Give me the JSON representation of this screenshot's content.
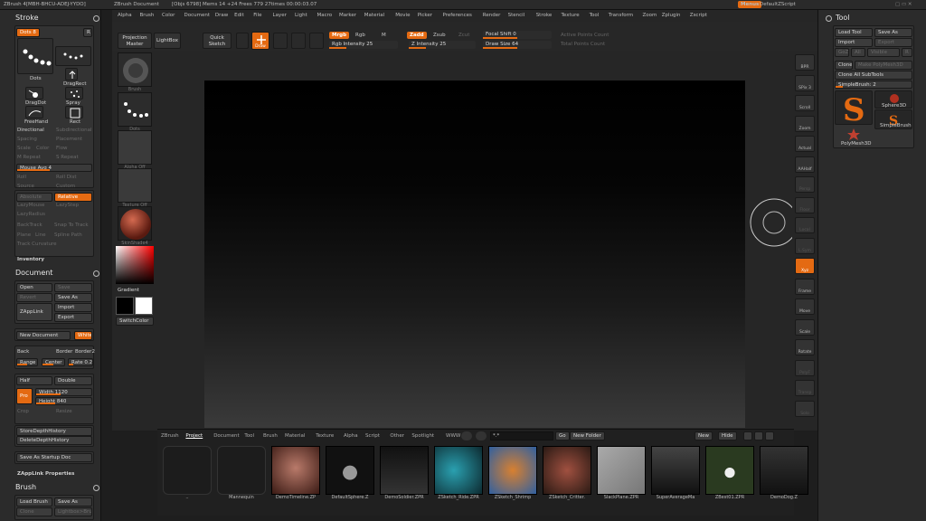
{
  "titlebar": {
    "app": "ZBrush 4[MBH-BHCU-ADEJ-YYDO]",
    "doc": "ZBrush Document",
    "stats": "[Objs 6798] Mems 14 +24 Frees 779 27times 00:00:03.07",
    "menus_btn": "Menus",
    "script_btn": "DefaultZScript"
  },
  "menubar": [
    "Alpha",
    "Brush",
    "Color",
    "Document",
    "Draw",
    "Edit",
    "File",
    "Layer",
    "Light",
    "Macro",
    "Marker",
    "Material",
    "Movie",
    "Picker",
    "Preferences",
    "Render",
    "Stencil",
    "Stroke",
    "Texture",
    "Tool",
    "Transform",
    "Zoom",
    "Zplugin",
    "Zscript"
  ],
  "toolbar": {
    "projection_master": "Projection Master",
    "lightbox": "LightBox",
    "quick_sketch": "Quick Sketch",
    "draw": "Draw",
    "mrgb": "Mrgb",
    "rgb": "Rgb",
    "m": "M",
    "rgb_intensity": "Rgb Intensity 25",
    "zadd": "Zadd",
    "zsub": "Zsub",
    "zcut": "Zcut",
    "z_intensity": "Z Intensity 25",
    "focal_shift": "Focal Shift 0",
    "draw_size": "Draw Size 64",
    "active_points": "Active Points Count",
    "total_points": "Total Points Count"
  },
  "left": {
    "stroke_title": "Stroke",
    "dots_label": "Dots 8",
    "r": "R",
    "icons": [
      "Dots",
      "DragRect",
      "DragDot",
      "Spray",
      "FreeHand",
      "Rect"
    ],
    "directional": "Directional",
    "subdirectional": "Subdirectional",
    "spacing": "Spacing",
    "placement": "Placement",
    "scale": "Scale",
    "color": "Color",
    "flow": "Flow",
    "repeat": "Repeat",
    "mrepeat": "M Repeat",
    "srepeat": "S Repeat",
    "mouse_avg": "Mouse Avg 4",
    "roll": "Roll",
    "roll_dist": "Roll Dist",
    "source": "Source",
    "custom": "Custom",
    "absolute": "Absolute",
    "relative": "Relative",
    "lazymouse": "LazyMouse",
    "lazystep": "LazyStep",
    "lazyradius": "LazyRadius",
    "backtrack": "BackTrack",
    "snapto": "Snap To Track",
    "plane": "Plane",
    "line": "Line",
    "spline": "Spline Path",
    "track_curvature": "Track Curvature",
    "inventory": "Inventory",
    "document_title": "Document",
    "open": "Open",
    "save": "Save",
    "revert": "Revert",
    "save_as": "Save As",
    "zapplink": "ZAppLink",
    "import": "Import",
    "export": "Export",
    "new_document": "New Document",
    "white": "White",
    "back": "Back",
    "border": "Border",
    "border2": "Border2",
    "range": "Range",
    "center": "Center",
    "rate": "Rate 0.2",
    "half": "Half",
    "double": "Double",
    "pro": "Pro",
    "width": "Width 1120",
    "height": "Height 840",
    "crop": "Crop",
    "resize": "Resize",
    "store_depth": "StoreDepthHistory",
    "delete_depth": "DeleteDepthHistory",
    "save_startup": "Save As Startup Doc",
    "zapplink_props": "ZAppLink Properties",
    "brush_title": "Brush",
    "load_brush": "Load Brush",
    "save_as_brush": "Save As",
    "clone": "Clone",
    "lightbox_brush": "Lightbox>Brushes"
  },
  "lshelf": {
    "brush": "Brush",
    "stroke": "Dots",
    "alpha": "Alpha Off",
    "texture": "Texture Off",
    "material": "SkinShade4",
    "gradient": "Gradient",
    "switchcolor": "SwitchColor"
  },
  "rshelf": [
    "BPR",
    "SPix 3",
    "Scroll",
    "Zoom",
    "Actual",
    "AAHalf",
    "Persp",
    "Floor",
    "Local",
    "L.Sym",
    "Xyz",
    "Frame",
    "Move",
    "Scale",
    "Rotate",
    "PolyF",
    "Transp",
    "Solo"
  ],
  "right": {
    "tool_title": "Tool",
    "load_tool": "Load Tool",
    "save_as": "Save As",
    "import": "Import",
    "export": "Export",
    "goz": "GoZ",
    "all": "All",
    "visible": "Visible",
    "r": "R",
    "clone": "Clone",
    "make_polymesh": "Make PolyMesh3D",
    "clone_all": "Clone All SubTools",
    "simplebrush": "SimpleBrush: 2",
    "sphere3d": "Sphere3D",
    "simplebrush_lbl": "SimpleBrush",
    "polymesh": "PolyMesh3D"
  },
  "lightbox": {
    "tabs": [
      "ZBrush",
      "Project",
      "Document",
      "Tool",
      "Brush",
      "Material",
      "Texture",
      "Alpha",
      "Script",
      "Other",
      "Spotlight",
      "WWW"
    ],
    "active": "Project",
    "search": "*.*",
    "go": "Go",
    "new_folder": "New Folder",
    "new": "New",
    "hide": "Hide",
    "items": [
      "..",
      "Mannequin",
      "DemoTimeline.ZP",
      "DefaultSphere.Z",
      "DemoSoldier.ZPR",
      "ZSketch_Ride.ZPR",
      "ZSketch_Shrimp",
      "ZSketch_Critter.",
      "SlackPlane.ZPR",
      "SuperAverageMa",
      "ZBest01.ZPR",
      "DemoDog.Z"
    ]
  }
}
